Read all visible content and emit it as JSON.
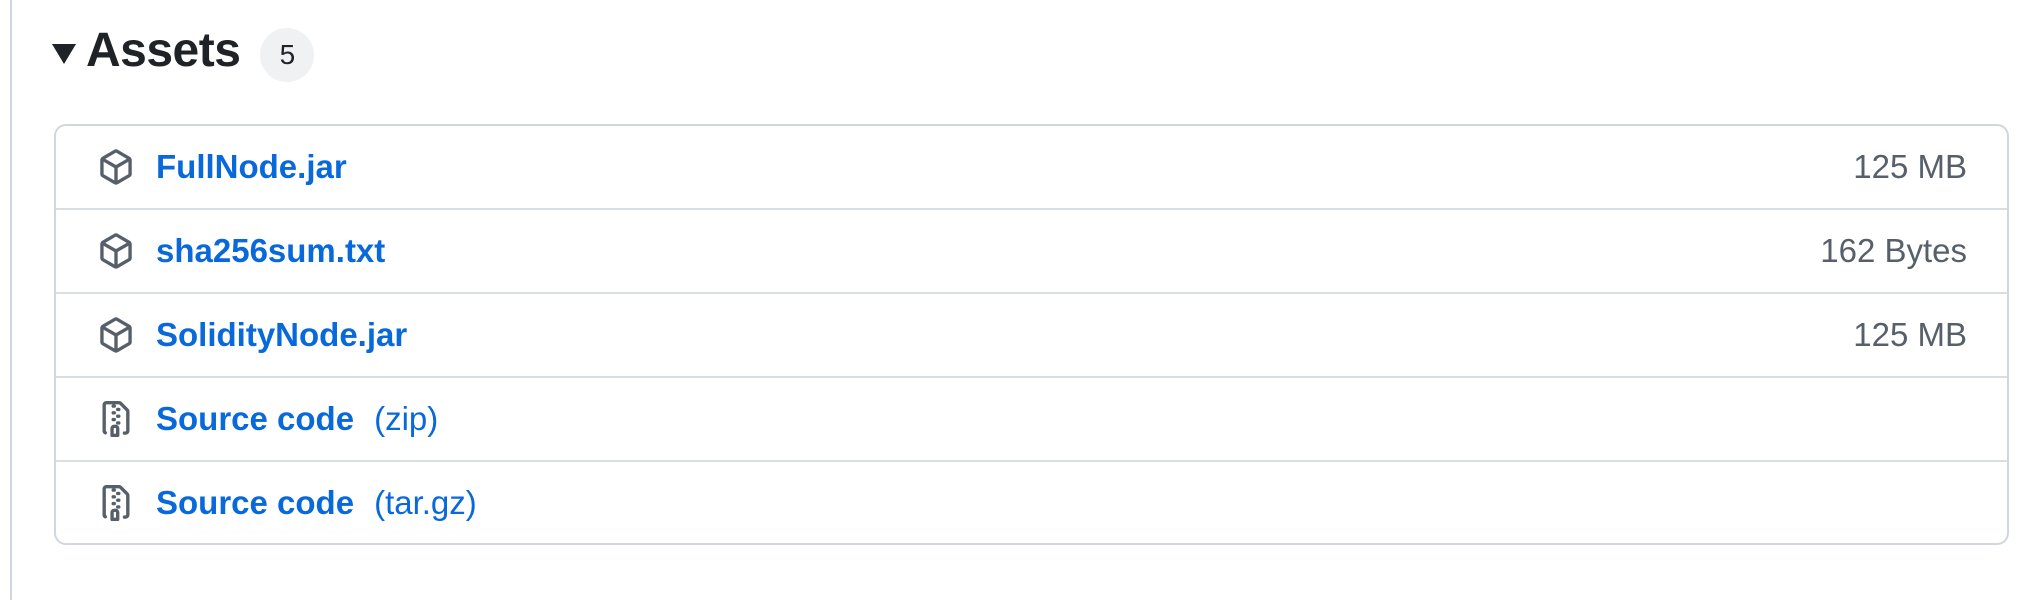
{
  "assets": {
    "title": "Assets",
    "count": "5",
    "items": [
      {
        "name": "FullNode.jar",
        "suffix": "",
        "size": "125 MB",
        "icon": "package-icon"
      },
      {
        "name": "sha256sum.txt",
        "suffix": "",
        "size": "162 Bytes",
        "icon": "package-icon"
      },
      {
        "name": "SolidityNode.jar",
        "suffix": "",
        "size": "125 MB",
        "icon": "package-icon"
      },
      {
        "name": "Source code",
        "suffix": "(zip)",
        "size": "",
        "icon": "file-zip-icon"
      },
      {
        "name": "Source code",
        "suffix": "(tar.gz)",
        "size": "",
        "icon": "file-zip-icon"
      }
    ]
  },
  "colors": {
    "link": "#0969da",
    "muted": "#57606a",
    "border": "#d0d7de",
    "counter_bg": "#eff1f3"
  }
}
